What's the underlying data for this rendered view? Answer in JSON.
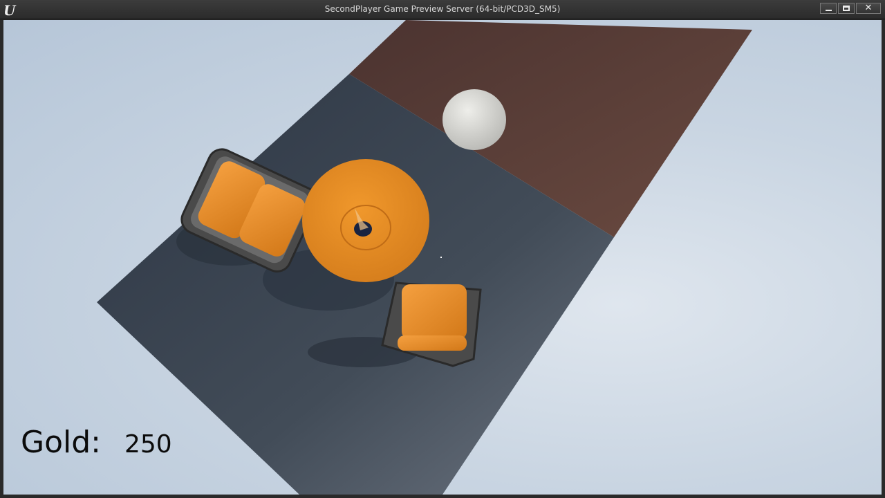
{
  "window": {
    "title": "SecondPlayer Game Preview Server (64-bit/PCD3D_SM5)",
    "app_icon": "unreal-engine-logo",
    "app_logo_text": "U",
    "buttons": {
      "minimize_icon": "minimize-icon",
      "maximize_icon": "maximize-icon",
      "close_icon": "close-icon",
      "close_glyph": "✕"
    }
  },
  "hud": {
    "gold_label": "Gold:",
    "gold_value": "250"
  },
  "scene": {
    "sky_color": "#c9d5e2",
    "floor_dark_color": "#3b4552",
    "floor_rust_color": "#5a3e38",
    "furniture_color": "#e08a24",
    "frame_color": "#4a4a4a",
    "ball_color": "#d9d9d6",
    "objects": [
      "floor-dark",
      "floor-rust",
      "ball",
      "table",
      "armchair-left",
      "armchair-right",
      "crosshair"
    ]
  }
}
